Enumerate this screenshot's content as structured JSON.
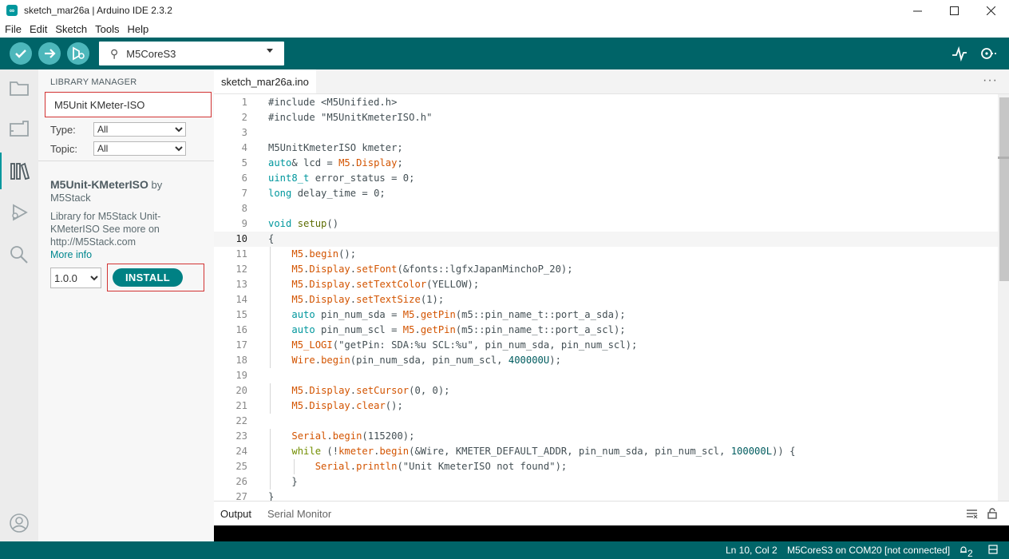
{
  "window": {
    "title": "sketch_mar26a | Arduino IDE 2.3.2",
    "controls": [
      "minimize",
      "maximize",
      "close"
    ]
  },
  "menu": [
    "File",
    "Edit",
    "Sketch",
    "Tools",
    "Help"
  ],
  "toolbar": {
    "board": "M5CoreS3",
    "buttons": [
      "verify",
      "upload",
      "debug"
    ],
    "right_icons": [
      "serial-plotter",
      "serial-monitor"
    ]
  },
  "library_manager": {
    "heading": "LIBRARY MANAGER",
    "search_value": "M5Unit KMeter-ISO",
    "type_label": "Type:",
    "type_value": "All",
    "topic_label": "Topic:",
    "topic_value": "All",
    "library": {
      "name": "M5Unit-KMeterISO",
      "by": " by",
      "author": "M5Stack",
      "desc_lines": [
        "Library for M5Stack Unit-",
        "KMeterISO See more on",
        "http://M5Stack.com"
      ],
      "more_info": "More info",
      "version": "1.0.0",
      "install_label": "INSTALL"
    }
  },
  "editor": {
    "tab": "sketch_mar26a.ino",
    "current_line": 10,
    "lines": [
      [
        [
          "#include <M5Unified.h>",
          "#434f54"
        ]
      ],
      [
        [
          "#include \"M5UnitKmeterISO.h\"",
          "#434f54"
        ]
      ],
      [],
      [
        [
          "M5UnitKmeterISO kmeter;",
          "#434f54"
        ]
      ],
      [
        [
          "auto",
          "#00979d"
        ],
        [
          "& lcd = ",
          "#434f54"
        ],
        [
          "M5",
          "#d35400"
        ],
        [
          ".",
          "#434f54"
        ],
        [
          "Display",
          "#d35400"
        ],
        [
          ";",
          "#434f54"
        ]
      ],
      [
        [
          "uint8_t",
          "#00979d"
        ],
        [
          " error_status = 0;",
          "#434f54"
        ]
      ],
      [
        [
          "long",
          "#00979d"
        ],
        [
          " delay_time = 0;",
          "#434f54"
        ]
      ],
      [],
      [
        [
          "void",
          "#00979d"
        ],
        [
          " ",
          "#434f54"
        ],
        [
          "setup",
          "#5e6d03"
        ],
        [
          "()",
          "#434f54"
        ]
      ],
      [
        [
          "{",
          "#434f54"
        ]
      ],
      [
        [
          "    ",
          "#434f54"
        ],
        [
          "M5",
          "#d35400"
        ],
        [
          ".",
          "#434f54"
        ],
        [
          "begin",
          "#d35400"
        ],
        [
          "();",
          "#434f54"
        ]
      ],
      [
        [
          "    ",
          "#434f54"
        ],
        [
          "M5",
          "#d35400"
        ],
        [
          ".",
          "#434f54"
        ],
        [
          "Display",
          "#d35400"
        ],
        [
          ".",
          "#434f54"
        ],
        [
          "setFont",
          "#d35400"
        ],
        [
          "(&fonts::lgfxJapanMinchoP_20);",
          "#434f54"
        ]
      ],
      [
        [
          "    ",
          "#434f54"
        ],
        [
          "M5",
          "#d35400"
        ],
        [
          ".",
          "#434f54"
        ],
        [
          "Display",
          "#d35400"
        ],
        [
          ".",
          "#434f54"
        ],
        [
          "setTextColor",
          "#d35400"
        ],
        [
          "(YELLOW);",
          "#434f54"
        ]
      ],
      [
        [
          "    ",
          "#434f54"
        ],
        [
          "M5",
          "#d35400"
        ],
        [
          ".",
          "#434f54"
        ],
        [
          "Display",
          "#d35400"
        ],
        [
          ".",
          "#434f54"
        ],
        [
          "setTextSize",
          "#d35400"
        ],
        [
          "(1);",
          "#434f54"
        ]
      ],
      [
        [
          "    ",
          "#434f54"
        ],
        [
          "auto",
          "#00979d"
        ],
        [
          " pin_num_sda = ",
          "#434f54"
        ],
        [
          "M5",
          "#d35400"
        ],
        [
          ".",
          "#434f54"
        ],
        [
          "getPin",
          "#d35400"
        ],
        [
          "(m5::pin_name_t::port_a_sda);",
          "#434f54"
        ]
      ],
      [
        [
          "    ",
          "#434f54"
        ],
        [
          "auto",
          "#00979d"
        ],
        [
          " pin_num_scl = ",
          "#434f54"
        ],
        [
          "M5",
          "#d35400"
        ],
        [
          ".",
          "#434f54"
        ],
        [
          "getPin",
          "#d35400"
        ],
        [
          "(m5::pin_name_t::port_a_scl);",
          "#434f54"
        ]
      ],
      [
        [
          "    ",
          "#434f54"
        ],
        [
          "M5_LOGI",
          "#d35400"
        ],
        [
          "(\"getPin: SDA:%u SCL:%u\", pin_num_sda, pin_num_scl);",
          "#434f54"
        ]
      ],
      [
        [
          "    ",
          "#434f54"
        ],
        [
          "Wire",
          "#d35400"
        ],
        [
          ".",
          "#434f54"
        ],
        [
          "begin",
          "#d35400"
        ],
        [
          "(pin_num_sda, pin_num_scl, ",
          "#434f54"
        ],
        [
          "400000U",
          "#005c5f"
        ],
        [
          ");",
          "#434f54"
        ]
      ],
      [],
      [
        [
          "    ",
          "#434f54"
        ],
        [
          "M5",
          "#d35400"
        ],
        [
          ".",
          "#434f54"
        ],
        [
          "Display",
          "#d35400"
        ],
        [
          ".",
          "#434f54"
        ],
        [
          "setCursor",
          "#d35400"
        ],
        [
          "(0, 0);",
          "#434f54"
        ]
      ],
      [
        [
          "    ",
          "#434f54"
        ],
        [
          "M5",
          "#d35400"
        ],
        [
          ".",
          "#434f54"
        ],
        [
          "Display",
          "#d35400"
        ],
        [
          ".",
          "#434f54"
        ],
        [
          "clear",
          "#d35400"
        ],
        [
          "();",
          "#434f54"
        ]
      ],
      [],
      [
        [
          "    ",
          "#434f54"
        ],
        [
          "Serial",
          "#d35400"
        ],
        [
          ".",
          "#434f54"
        ],
        [
          "begin",
          "#d35400"
        ],
        [
          "(115200);",
          "#434f54"
        ]
      ],
      [
        [
          "    ",
          "#434f54"
        ],
        [
          "while",
          "#728e00"
        ],
        [
          " (!",
          "#434f54"
        ],
        [
          "kmeter",
          "#d35400"
        ],
        [
          ".",
          "#434f54"
        ],
        [
          "begin",
          "#d35400"
        ],
        [
          "(&Wire, KMETER_DEFAULT_ADDR, pin_num_sda, pin_num_scl, ",
          "#434f54"
        ],
        [
          "100000L",
          "#005c5f"
        ],
        [
          ")) {",
          "#434f54"
        ]
      ],
      [
        [
          "        ",
          "#434f54"
        ],
        [
          "Serial",
          "#d35400"
        ],
        [
          ".",
          "#434f54"
        ],
        [
          "println",
          "#d35400"
        ],
        [
          "(\"Unit KmeterISO not found\");",
          "#434f54"
        ]
      ],
      [
        [
          "    }",
          "#434f54"
        ]
      ],
      [
        [
          "}",
          "#434f54"
        ]
      ]
    ]
  },
  "output_panel": {
    "tabs": [
      "Output",
      "Serial Monitor"
    ]
  },
  "status": {
    "position": "Ln 10, Col 2",
    "board_port": "M5CoreS3 on COM20 [not connected]",
    "notifications": "2"
  }
}
